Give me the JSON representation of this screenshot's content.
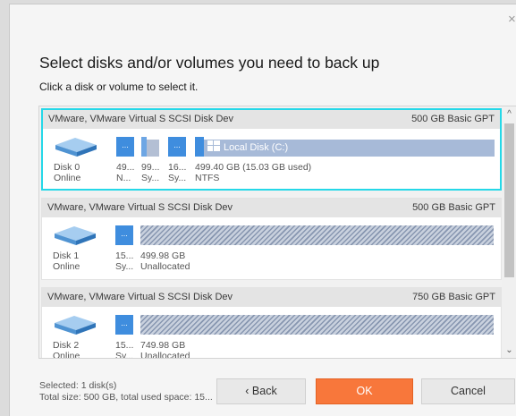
{
  "dialog": {
    "title": "Select disks and/or volumes you need to back up",
    "subtitle": "Click a disk or volume to select it."
  },
  "disks": [
    {
      "name": "VMware, VMware Virtual S SCSI Disk Dev",
      "info": "500 GB Basic GPT",
      "label": "Disk 0",
      "status": "Online",
      "selected": true,
      "partitions": [
        {
          "size": "49...",
          "type": "N..."
        },
        {
          "size": "99...",
          "type": "Sy..."
        },
        {
          "size": "16...",
          "type": "Sy..."
        }
      ],
      "volume": {
        "title": "Local Disk (C:)",
        "size": "499.40 GB (15.03 GB used)",
        "fs": "NTFS",
        "used_fraction": 0.03
      }
    },
    {
      "name": "VMware, VMware Virtual S SCSI Disk Dev",
      "info": "500 GB Basic GPT",
      "label": "Disk 1",
      "status": "Online",
      "selected": false,
      "partitions": [
        {
          "size": "15...",
          "type": "Sy..."
        }
      ],
      "volume": {
        "size": "499.98 GB",
        "fs": "Unallocated"
      }
    },
    {
      "name": "VMware, VMware Virtual S SCSI Disk Dev",
      "info": "750 GB Basic GPT",
      "label": "Disk 2",
      "status": "Online",
      "selected": false,
      "partitions": [
        {
          "size": "15...",
          "type": "Sy..."
        }
      ],
      "volume": {
        "size": "749.98 GB",
        "fs": "Unallocated"
      }
    }
  ],
  "partition_glyph": "...",
  "footer": {
    "selected": "Selected: 1 disk(s)",
    "total": "Total size: 500 GB, total used space: 15..."
  },
  "buttons": {
    "back": "‹ Back",
    "ok": "OK",
    "cancel": "Cancel"
  },
  "icons": {
    "close": "×",
    "scroll_up": "^",
    "scroll_down": "⌄"
  },
  "colors": {
    "accent": "#f8773b",
    "selection": "#25d8e8",
    "partition": "#3f8dde"
  }
}
